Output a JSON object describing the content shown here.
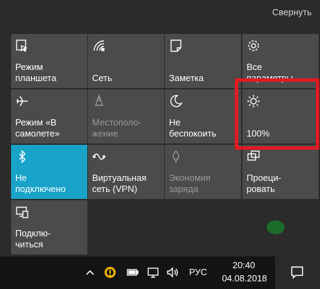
{
  "header": {
    "collapse_label": "Свернуть"
  },
  "tiles": [
    {
      "label": "Режим\nпланшета",
      "icon": "tablet-mode-icon",
      "state": "normal"
    },
    {
      "label": "Сеть",
      "icon": "network-icon",
      "state": "normal"
    },
    {
      "label": "Заметка",
      "icon": "note-icon",
      "state": "normal"
    },
    {
      "label": "Все\nпараметры",
      "icon": "gear-icon",
      "state": "normal"
    },
    {
      "label": "Режим «В\nсамолете»",
      "icon": "airplane-icon",
      "state": "normal"
    },
    {
      "label": "Местополо-\nжение",
      "icon": "location-icon",
      "state": "disabled"
    },
    {
      "label": "Не\nбеспокоить",
      "icon": "moon-icon",
      "state": "normal"
    },
    {
      "label": "100%",
      "icon": "brightness-icon",
      "state": "normal"
    },
    {
      "label": "Не\nподключено",
      "icon": "bluetooth-icon",
      "state": "active"
    },
    {
      "label": "Виртуальная\nсеть (VPN)",
      "icon": "vpn-icon",
      "state": "normal"
    },
    {
      "label": "Экономия\nзаряда",
      "icon": "battery-saver-icon",
      "state": "disabled"
    },
    {
      "label": "Проеци-\nровать",
      "icon": "project-icon",
      "state": "normal"
    },
    {
      "label": "Подклю-\nчиться",
      "icon": "connect-icon",
      "state": "normal"
    }
  ],
  "taskbar": {
    "language": "РУС",
    "time": "20:40",
    "date": "04.08.2018",
    "tray_icons": [
      "chevron-up-icon",
      "app-icon",
      "battery-icon",
      "monitor-icon",
      "volume-icon"
    ],
    "notification_icon": "notification-icon"
  },
  "colors": {
    "active": "#1aa3c8",
    "tile": "#4b4b4b",
    "highlight": "#e01b24"
  }
}
